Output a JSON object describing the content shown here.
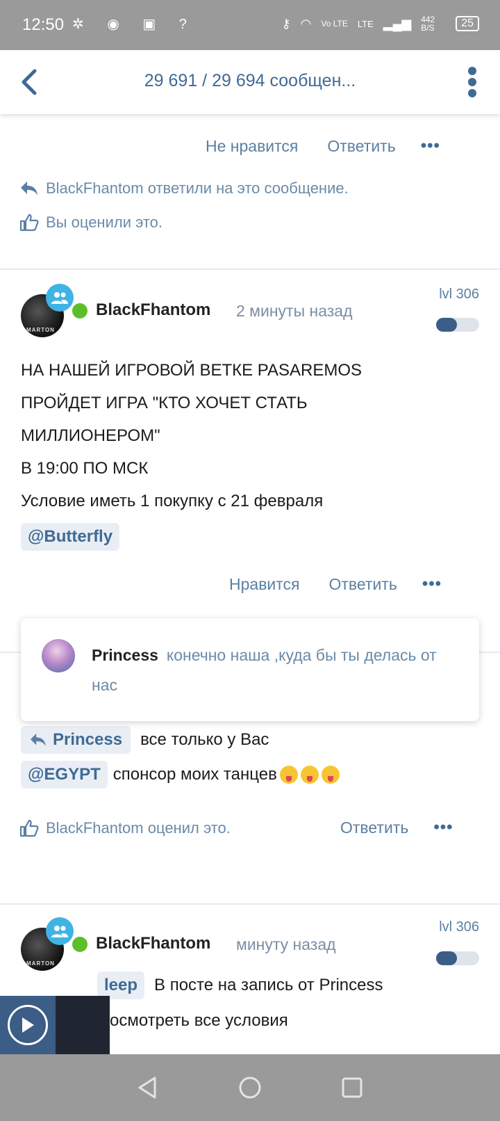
{
  "status_bar": {
    "time": "12:50",
    "network": "Vo LTE",
    "lte": "LTE",
    "speed": "442 B/S",
    "battery": "25"
  },
  "header": {
    "title": "29 691 / 29 694 сообщен..."
  },
  "prev_post": {
    "dislike_label": "Не нравится",
    "reply_label": "Ответить",
    "more_label": "•••",
    "replied_note": "BlackFhantom ответили на это сообщение.",
    "liked_note": "Вы оценили это."
  },
  "post1": {
    "author": "BlackFhantom",
    "time": "2 минуты назад",
    "level": "lvl 306",
    "avatar_text": "MARTON",
    "lines": [
      "НА НАШЕЙ ИГРОВОЙ ВЕТКЕ PASAREMOS",
      "ПРОЙДЕТ ИГРА \"КТО ХОЧЕТ СТАТЬ",
      "МИЛЛИОНЕРОМ\"",
      "В 19:00 ПО МСК",
      "Условие иметь 1 покупку с 21 февраля"
    ],
    "mention": "@Butterfly",
    "like_label": "Нравится",
    "reply_label": "Ответить",
    "more_label": "•••"
  },
  "quote": {
    "name": "Princess",
    "text": "конечно наша ,куда бы ты делась от нас"
  },
  "post2": {
    "reply_chip": "Princess",
    "reply_text": "все только у Вас",
    "mention": "@EGYPT",
    "mention_text": "спонсор моих танцев",
    "liked_note": "BlackFhantom оценил это.",
    "reply_label": "Ответить",
    "more_label": "•••"
  },
  "post3": {
    "author": "BlackFhantom",
    "time": "минуту назад",
    "level": "lvl 306",
    "mention_partial": "leep",
    "text1": "В посте на запись от Princess",
    "text2": "осмотреть все условия"
  },
  "colors": {
    "accent": "#3f6a95",
    "online": "#5cbf2a",
    "status_bar": "#9a9a9a"
  }
}
